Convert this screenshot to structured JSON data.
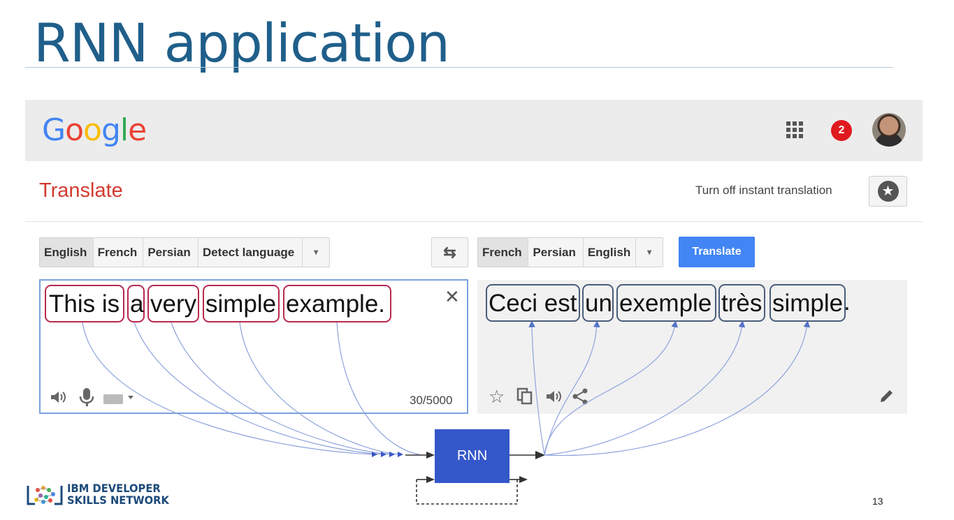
{
  "slide": {
    "title": "RNN application",
    "page_number": "13"
  },
  "google_bar": {
    "logo_letters": [
      {
        "ch": "G",
        "color": "#4285f4"
      },
      {
        "ch": "o",
        "color": "#ea4335"
      },
      {
        "ch": "o",
        "color": "#fbbc05"
      },
      {
        "ch": "g",
        "color": "#4285f4"
      },
      {
        "ch": "l",
        "color": "#34a853"
      },
      {
        "ch": "e",
        "color": "#ea4335"
      }
    ],
    "apps_icon": "apps-grid-icon",
    "notification_count": "2",
    "avatar_icon": "user-avatar"
  },
  "translate": {
    "title": "Translate",
    "instant_toggle": "Turn off instant translation",
    "star_icon": "star-icon",
    "source_languages": [
      "English",
      "French",
      "Persian",
      "Detect language"
    ],
    "target_languages": [
      "French",
      "Persian",
      "English"
    ],
    "dropdown_glyph": "▾",
    "swap_glyph": "⇆",
    "translate_button": "Translate",
    "source_words": [
      "This is",
      "a",
      "very",
      "simple",
      "example."
    ],
    "target_words": [
      "Ceci est",
      "un",
      "exemple",
      "très",
      "simple"
    ],
    "target_trailing": ".",
    "clear_glyph": "✕",
    "char_count": "30/5000",
    "source_tools": [
      "speaker-icon",
      "microphone-icon",
      "keyboard-icon"
    ],
    "target_tools": [
      "star-outline-icon",
      "copy-icon",
      "speaker-icon",
      "share-icon"
    ],
    "edit_icon": "pencil-icon"
  },
  "diagram": {
    "rnn_label": "RNN"
  },
  "branding": {
    "line1": "IBM DEVELOPER",
    "line2": "SKILLS NETWORK"
  },
  "colors": {
    "title": "#1f5f8a",
    "source_box": "#b8294f",
    "target_box": "#4a5d7c",
    "rnn": "#3457c9",
    "translate_btn": "#4285f4",
    "flow_line": "#7b93d8"
  }
}
